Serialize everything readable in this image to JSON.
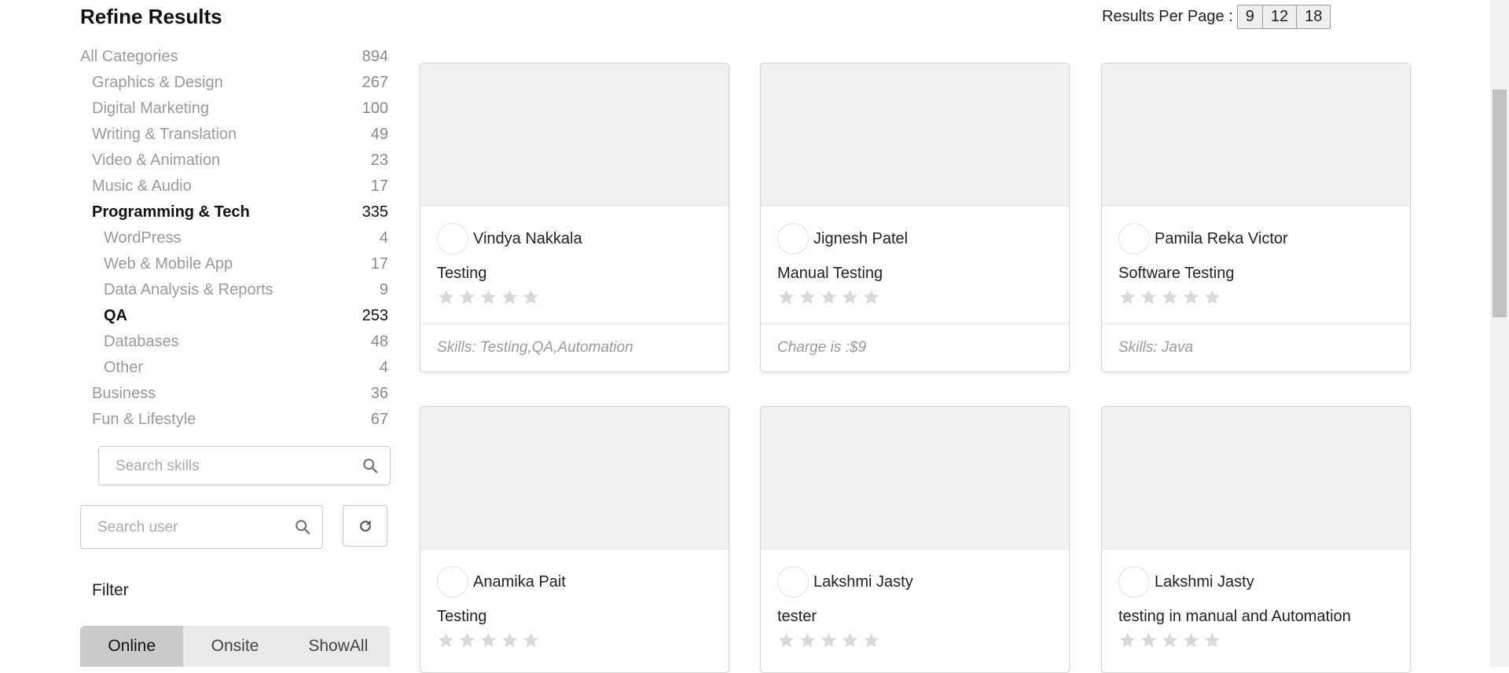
{
  "sidebar": {
    "title": "Refine Results",
    "categories": [
      {
        "label": "All Categories",
        "count": "894",
        "level": 0,
        "bold": false
      },
      {
        "label": "Graphics & Design",
        "count": "267",
        "level": 1,
        "bold": false
      },
      {
        "label": "Digital Marketing",
        "count": "100",
        "level": 1,
        "bold": false
      },
      {
        "label": "Writing & Translation",
        "count": "49",
        "level": 1,
        "bold": false
      },
      {
        "label": "Video & Animation",
        "count": "23",
        "level": 1,
        "bold": false
      },
      {
        "label": "Music & Audio",
        "count": "17",
        "level": 1,
        "bold": false
      },
      {
        "label": "Programming & Tech",
        "count": "335",
        "level": 1,
        "bold": true
      },
      {
        "label": "WordPress",
        "count": "4",
        "level": 2,
        "bold": false
      },
      {
        "label": "Web & Mobile App",
        "count": "17",
        "level": 2,
        "bold": false
      },
      {
        "label": "Data Analysis & Reports",
        "count": "9",
        "level": 2,
        "bold": false
      },
      {
        "label": "QA",
        "count": "253",
        "level": 2,
        "bold": true
      },
      {
        "label": "Databases",
        "count": "48",
        "level": 2,
        "bold": false
      },
      {
        "label": "Other",
        "count": "4",
        "level": 2,
        "bold": false
      },
      {
        "label": "Business",
        "count": "36",
        "level": 1,
        "bold": false
      },
      {
        "label": "Fun & Lifestyle",
        "count": "67",
        "level": 1,
        "bold": false
      }
    ],
    "search_skills_placeholder": "Search skills",
    "search_user_placeholder": "Search user",
    "filter_label": "Filter",
    "filter_options": [
      "Online",
      "Onsite",
      "ShowAll"
    ],
    "filter_selected": "Online"
  },
  "results_per_page": {
    "label": "Results Per Page :",
    "options": [
      "9",
      "12",
      "18"
    ]
  },
  "cards": [
    {
      "user": "Vindya Nakkala",
      "title": "Testing",
      "footer": "Skills: Testing,QA,Automation",
      "rating": 0
    },
    {
      "user": "Jignesh Patel",
      "title": "Manual Testing",
      "footer": "Charge is :$9",
      "rating": 0
    },
    {
      "user": "Pamila Reka Victor",
      "title": "Software Testing",
      "footer": "Skills: Java",
      "rating": 0
    },
    {
      "user": "Anamika Pait",
      "title": "Testing",
      "footer": "",
      "rating": 0
    },
    {
      "user": "Lakshmi Jasty",
      "title": "tester",
      "footer": "",
      "rating": 0
    },
    {
      "user": "Lakshmi Jasty",
      "title": "testing in manual and Automation",
      "footer": "",
      "rating": 0
    }
  ],
  "colors": {
    "star_empty": "#d9d9d9",
    "thumb_bg": "#f1f1f1",
    "segment_active": "#c9c9c9"
  }
}
